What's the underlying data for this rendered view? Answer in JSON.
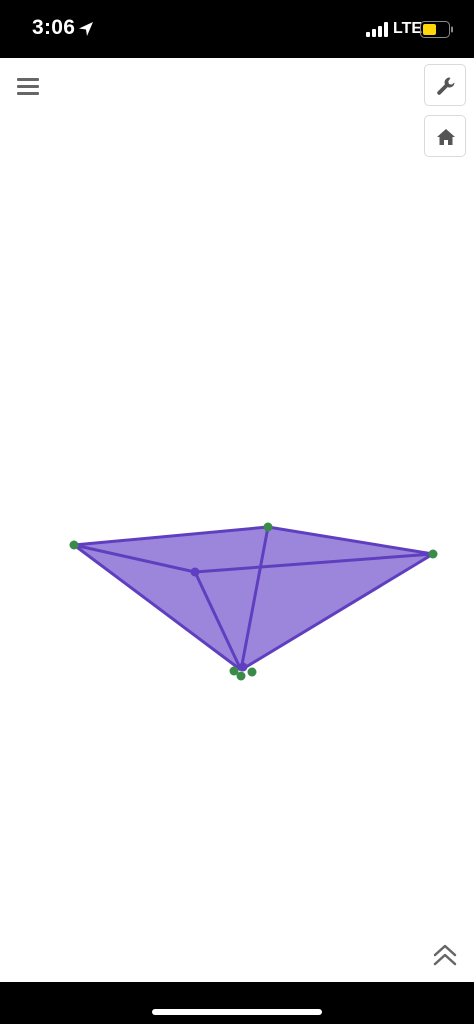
{
  "status_bar": {
    "time": "3:06",
    "network": "LTE",
    "battery_color": "#ffd60a",
    "location_icon": "location-arrow-icon",
    "signal_icon": "cellular-signal-icon",
    "battery_icon": "battery-icon"
  },
  "toolbar": {
    "menu_icon": "hamburger-menu-icon",
    "settings_icon": "wrench-icon",
    "home_icon": "home-icon",
    "collapse_icon": "double-chevron-up-icon"
  },
  "graphics": {
    "shape": "tetrahedron",
    "fill_color": "#9c86dc",
    "edge_color": "#5f3fbf",
    "vertex_color": "#3a8a4a",
    "inner_vertex_color": "#5f3fbf"
  }
}
